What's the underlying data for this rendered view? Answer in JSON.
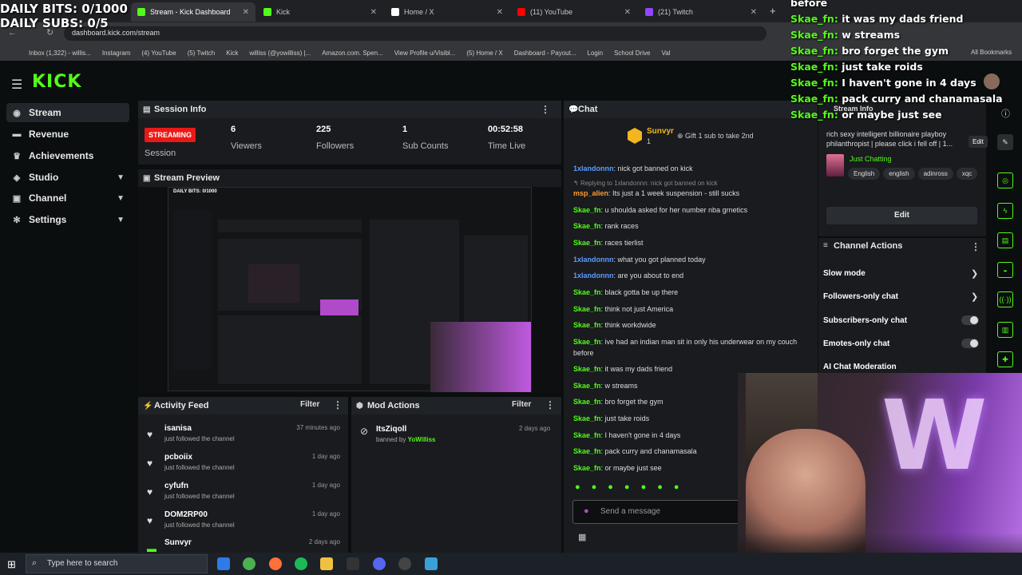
{
  "overlay": {
    "bits": "DAILY BITS: 0/1000",
    "subs": "DAILY SUBS: 0/5"
  },
  "browser": {
    "tabs": [
      {
        "label": "Stream - Kick Dashboard",
        "color": "#53fc18"
      },
      {
        "label": "Kick",
        "color": "#53fc18"
      },
      {
        "label": "Home / X",
        "color": "#ffffff"
      },
      {
        "label": "(11) YouTube",
        "color": "#ff0000"
      },
      {
        "label": "(21) Twitch",
        "color": "#9146ff"
      }
    ],
    "url": "dashboard.kick.com/stream",
    "bookmarks": [
      "Inbox (1,322) - willis...",
      "Instagram",
      "(4) YouTube",
      "(5) Twitch",
      "Kick",
      "williss (@yowilliss) |...",
      "Amazon.com. Spen...",
      "View Profile u/Visibl...",
      "(5) Home / X",
      "Dashboard - Payout...",
      "Login",
      "School Drive",
      "Val"
    ],
    "all_bookmarks": "All Bookmarks"
  },
  "sidebar": {
    "logo": "KICK",
    "items": [
      {
        "label": "Stream",
        "icon": "broadcast-icon"
      },
      {
        "label": "Revenue",
        "icon": "money-icon"
      },
      {
        "label": "Achievements",
        "icon": "trophy-icon"
      },
      {
        "label": "Studio",
        "icon": "studio-icon"
      },
      {
        "label": "Channel",
        "icon": "channel-icon"
      },
      {
        "label": "Settings",
        "icon": "gear-icon"
      }
    ]
  },
  "session": {
    "title": "Session Info",
    "status": "STREAMING",
    "status_label": "Session",
    "viewers": "6",
    "viewers_label": "Viewers",
    "followers": "225",
    "followers_label": "Followers",
    "subs": "1",
    "subs_label": "Sub Counts",
    "time": "00:52:58",
    "time_label": "Time Live"
  },
  "preview": {
    "title": "Stream Preview"
  },
  "activity": {
    "title": "Activity Feed",
    "filter": "Filter",
    "items": [
      {
        "name": "isanisa",
        "sub": "just followed the channel",
        "time": "37 minutes ago"
      },
      {
        "name": "pcboiix",
        "sub": "just followed the channel",
        "time": "1 day ago"
      },
      {
        "name": "cyfufn",
        "sub": "just followed the channel",
        "time": "1 day ago"
      },
      {
        "name": "DOM2RP00",
        "sub": "just followed the channel",
        "time": "1 day ago"
      },
      {
        "name": "Sunvyr",
        "sub": "",
        "time": "2 days ago"
      }
    ]
  },
  "mod": {
    "title": "Mod Actions",
    "filter": "Filter",
    "item": {
      "name": "ItsZiqoll",
      "action": "banned by",
      "by": "YoWilliss",
      "time": "2 days ago"
    }
  },
  "chat": {
    "title": "Chat",
    "pinned_user": "Sunvyr",
    "pinned_count": "1",
    "gift_text": "Gift 1 sub to take 2nd",
    "reply_text": "Replying to 1xlandonnn: nick got banned on kick",
    "messages": [
      {
        "user": "1xlandonnn",
        "text": "nick got banned on kick",
        "color": "#5a9cff"
      },
      {
        "user": "msp_alien",
        "text": "Its just a 1 week suspension - still sucks",
        "color": "#ff9b2f"
      },
      {
        "user": "Skae_fn",
        "text": "u shoulda asked for her number nba grnetics",
        "color": "#53fc18"
      },
      {
        "user": "Skae_fn",
        "text": "rank races",
        "color": "#53fc18"
      },
      {
        "user": "Skae_fn",
        "text": "races tierlist",
        "color": "#53fc18"
      },
      {
        "user": "1xlandonnn",
        "text": "what you got planned today",
        "color": "#5a9cff"
      },
      {
        "user": "1xlandonnn",
        "text": "are you about to end",
        "color": "#5a9cff"
      },
      {
        "user": "Skae_fn",
        "text": "black gotta be up there",
        "color": "#53fc18"
      },
      {
        "user": "Skae_fn",
        "text": "think not just America",
        "color": "#53fc18"
      },
      {
        "user": "Skae_fn",
        "text": "think workdwide",
        "color": "#53fc18"
      },
      {
        "user": "Skae_fn",
        "text": "ive had an indian man sit in only his underwear on my couch before",
        "color": "#53fc18"
      },
      {
        "user": "Skae_fn",
        "text": "it was my dads friend",
        "color": "#53fc18"
      },
      {
        "user": "Skae_fn",
        "text": "w streams",
        "color": "#53fc18"
      },
      {
        "user": "Skae_fn",
        "text": "bro forget the gym",
        "color": "#53fc18"
      },
      {
        "user": "Skae_fn",
        "text": "just take roids",
        "color": "#53fc18"
      },
      {
        "user": "Skae_fn",
        "text": "I haven't gone in 4 days",
        "color": "#53fc18"
      },
      {
        "user": "Skae_fn",
        "text": "pack curry and chanamasala",
        "color": "#53fc18"
      },
      {
        "user": "Skae_fn",
        "text": "or maybe just see",
        "color": "#53fc18"
      }
    ],
    "placeholder": "Send a message"
  },
  "stream_info": {
    "title": "Stream Info",
    "description": "rich sexy intelligent billionaire playboy philanthropist | please click i fell off | 1...",
    "edit_tip": "Edit",
    "category": "Just Chatting",
    "tags": [
      "English",
      "english",
      "adinross",
      "xqc"
    ],
    "edit": "Edit"
  },
  "channel_actions": {
    "title": "Channel Actions",
    "items": [
      "Slow mode",
      "Followers-only chat",
      "Subscribers-only chat",
      "Emotes-only chat",
      "AI Chat Moderation"
    ]
  },
  "overlay_chat": [
    {
      "user": "",
      "text": "before"
    },
    {
      "user": "Skae_fn:",
      "text": "it was my dads friend"
    },
    {
      "user": "Skae_fn:",
      "text": "w streams"
    },
    {
      "user": "Skae_fn:",
      "text": "bro forget the gym"
    },
    {
      "user": "Skae_fn:",
      "text": "just take roids"
    },
    {
      "user": "Skae_fn:",
      "text": "I haven't gone in 4 days"
    },
    {
      "user": "Skae_fn:",
      "text": "pack curry and chanamasala"
    },
    {
      "user": "Skae_fn:",
      "text": "or maybe just see"
    }
  ],
  "taskbar": {
    "search": "Type here to search"
  }
}
